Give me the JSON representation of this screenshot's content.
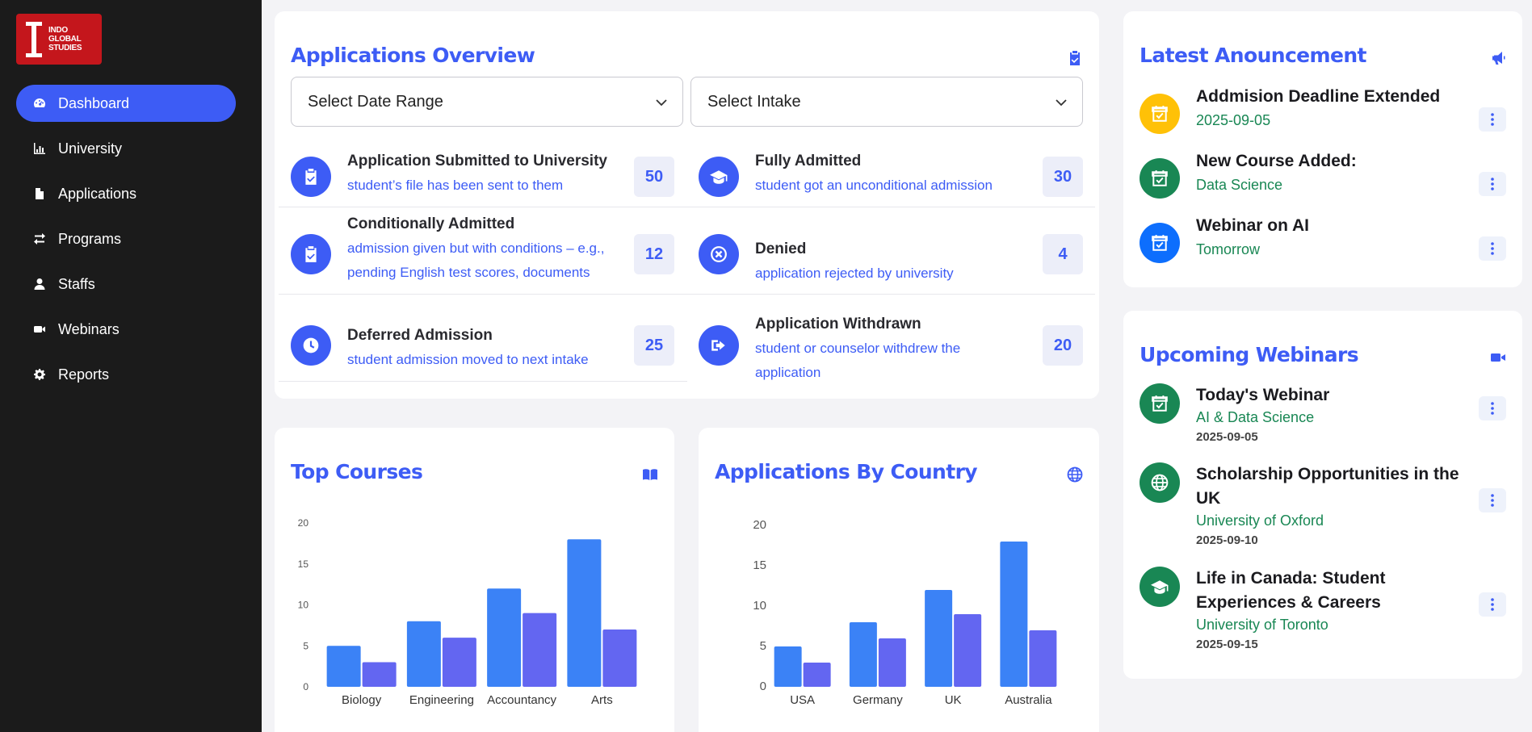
{
  "brand": {
    "logo_line1": "INDO",
    "logo_line2": "GLOBAL",
    "logo_line3": "STUDIES"
  },
  "sidebar": {
    "items": [
      {
        "label": "Dashboard",
        "icon": "gauge-icon",
        "active": true
      },
      {
        "label": "University",
        "icon": "bar-chart-icon"
      },
      {
        "label": "Applications",
        "icon": "file-icon"
      },
      {
        "label": "Programs",
        "icon": "exchange-icon"
      },
      {
        "label": "Staffs",
        "icon": "user-icon"
      },
      {
        "label": "Webinars",
        "icon": "video-icon"
      },
      {
        "label": "Reports",
        "icon": "gear-icon"
      }
    ]
  },
  "overview": {
    "title": "Applications Overview",
    "date_select": "Select Date Range",
    "intake_select": "Select Intake",
    "stats": [
      {
        "title": "Application Submitted to University",
        "desc": "student’s file has been sent to them",
        "count": "50",
        "icon": "clipboard-check-icon"
      },
      {
        "title": "Fully Admitted",
        "desc": "student got an unconditional admission",
        "count": "30",
        "icon": "graduation-cap-icon"
      },
      {
        "title": "Conditionally Admitted",
        "desc": "admission given but with conditions – e.g., pending English test scores, documents",
        "count": "12",
        "icon": "clipboard-check-icon"
      },
      {
        "title": "Denied",
        "desc": "application rejected by university",
        "count": "4",
        "icon": "x-circle-icon"
      },
      {
        "title": "Deferred Admission",
        "desc": "student admission moved to next intake",
        "count": "25",
        "icon": "clock-icon"
      },
      {
        "title": "Application Withdrawn",
        "desc": "student or counselor withdrew the application",
        "count": "20",
        "icon": "sign-out-icon"
      }
    ]
  },
  "top_courses": {
    "title": "Top Courses",
    "icon": "book-icon"
  },
  "by_country": {
    "title": "Applications By Country",
    "icon": "globe-icon"
  },
  "chart_data": [
    {
      "type": "bar",
      "categories": [
        "Biology",
        "Engineering",
        "Accountancy",
        "Arts"
      ],
      "series": [
        {
          "values": [
            5,
            8,
            12,
            18
          ],
          "color": "#3b82f6"
        },
        {
          "values": [
            3,
            6,
            9,
            7
          ],
          "color": "#6366f1"
        }
      ],
      "ylim": [
        0,
        20
      ],
      "yticks": [
        0,
        5,
        10,
        15,
        20
      ]
    },
    {
      "type": "bar",
      "categories": [
        "USA",
        "Germany",
        "UK",
        "Australia"
      ],
      "series": [
        {
          "values": [
            5,
            8,
            12,
            18
          ],
          "color": "#3b82f6"
        },
        {
          "values": [
            3,
            6,
            9,
            7
          ],
          "color": "#6366f1"
        }
      ],
      "ylim": [
        0,
        20
      ],
      "yticks": [
        0,
        5,
        10,
        15,
        20
      ]
    }
  ],
  "announcements": {
    "title": "Latest Anouncement",
    "icon": "megaphone-icon",
    "items": [
      {
        "title": "Addmision Deadline Extended",
        "sub": "2025-09-05",
        "color": "#ffc107"
      },
      {
        "title": "New Course Added:",
        "sub": "Data Science",
        "color": "#198754"
      },
      {
        "title": "Webinar on AI",
        "sub": "Tomorrow",
        "color": "#0d6efd"
      }
    ]
  },
  "webinars": {
    "title": "Upcoming Webinars",
    "icon": "video-icon",
    "items": [
      {
        "title": "Today's Webinar",
        "sub": "AI & Data Science",
        "date": "2025-09-05",
        "icon": "calendar-check-icon"
      },
      {
        "title": "Scholarship Opportunities in the UK",
        "sub": "University of Oxford",
        "date": "2025-09-10",
        "icon": "globe-icon"
      },
      {
        "title": "Life in Canada: Student Experiences & Careers",
        "sub": "University of Toronto",
        "date": "2025-09-15",
        "icon": "graduation-cap-icon"
      }
    ]
  },
  "colors": {
    "accent": "#3d5cf5",
    "sidebar": "#1b1b1b",
    "success": "#198754",
    "warning": "#ffc107",
    "primary": "#0d6efd"
  }
}
